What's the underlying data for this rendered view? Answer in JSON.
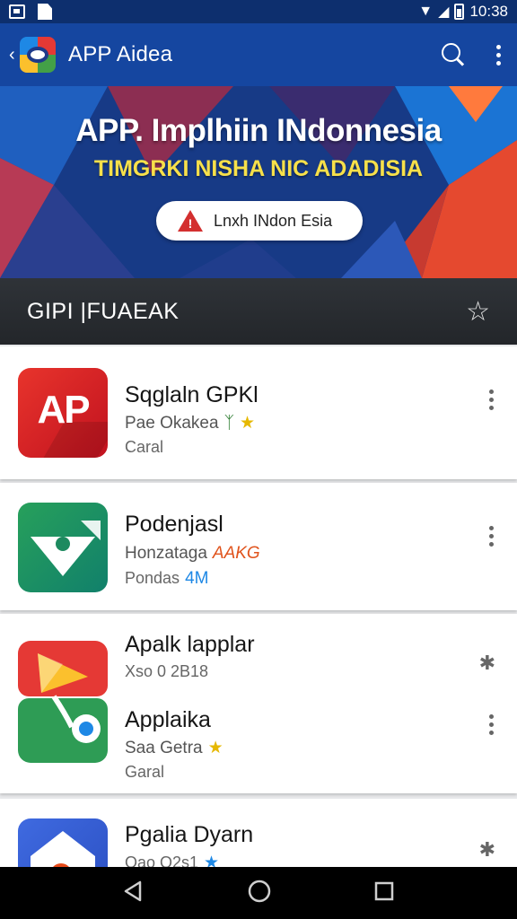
{
  "status_bar": {
    "time": "10:38"
  },
  "app_bar": {
    "title": "APP Aidea",
    "icons": [
      "back-icon",
      "app-logo",
      "search-icon",
      "more-icon"
    ]
  },
  "banner": {
    "title": "APP. Implhiin INdonnesia",
    "subtitle": "TIMGRKI NISHA NIC ADADISIA",
    "pill_label": "Lnxh INdon Esia"
  },
  "section": {
    "title": "GIPI |FUAEAK"
  },
  "apps": [
    {
      "title": "Sqglaln GPKl",
      "subtitle": "Pae Okakea",
      "meta": "Caral"
    },
    {
      "title": "Podenjasl",
      "subtitle": "Honzataga",
      "tag": "AAKG",
      "meta": "Pondas",
      "meta_tag": "4M"
    },
    {
      "title": "Apalk lapplar",
      "subtitle": "Xso 0 2B18"
    },
    {
      "title": "Applaika",
      "subtitle": "Saa Getra",
      "meta": "Garal"
    },
    {
      "title": "Pgalia Dyarn",
      "subtitle": "Oao Q2s1"
    }
  ],
  "colors": {
    "primary": "#1546a0",
    "status": "#0d2f6e",
    "section": "#2b2e33",
    "star": "#e6b800"
  }
}
